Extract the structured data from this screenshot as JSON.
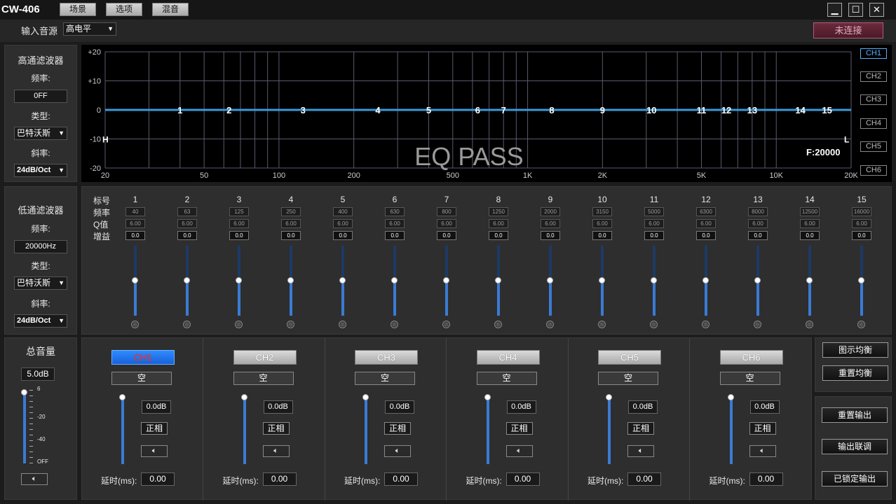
{
  "app": {
    "title": "CW-406"
  },
  "menu": [
    {
      "label": "场景"
    },
    {
      "label": "选项"
    },
    {
      "label": "混音"
    }
  ],
  "window_controls": {
    "minimize": "▁",
    "maximize": "☐",
    "close": "✕"
  },
  "input_bar": {
    "label": "输入音源",
    "value": "高电平",
    "status": "未连接"
  },
  "highpass": {
    "title": "高通滤波器",
    "freq_label": "频率:",
    "freq": "0FF",
    "type_label": "类型:",
    "type": "巴特沃斯",
    "slope_label": "斜率:",
    "slope": "24dB/Oct"
  },
  "lowpass": {
    "title": "低通滤波器",
    "freq_label": "频率:",
    "freq": "20000Hz",
    "type_label": "类型:",
    "type": "巴特沃斯",
    "slope_label": "斜率:",
    "slope": "24dB/Oct"
  },
  "graph": {
    "overlay": "EQ PASS",
    "freq_readout": "F:20000",
    "hp_marker": "H",
    "lp_marker": "L",
    "y_ticks": [
      "+20",
      "+10",
      "0",
      "-10",
      "-20"
    ],
    "x_ticks": [
      "20",
      "50",
      "100",
      "200",
      "500",
      "1K",
      "2K",
      "5K",
      "10K",
      "20K"
    ],
    "band_markers": [
      "1",
      "2",
      "3",
      "4",
      "5",
      "6",
      "7",
      "8",
      "9",
      "10",
      "11",
      "12",
      "13",
      "14",
      "15"
    ],
    "channels": [
      "CH1",
      "CH2",
      "CH3",
      "CH4",
      "CH5",
      "CH6"
    ],
    "active_channel": "CH1",
    "curve_color": "#3a9ad9"
  },
  "eq": {
    "row_labels": {
      "num": "标号",
      "freq": "频率",
      "q": "Q值",
      "gain": "增益"
    },
    "bands": [
      {
        "num": "1",
        "freq": "40",
        "q": "6.00",
        "gain": "0.0",
        "level": 0.5
      },
      {
        "num": "2",
        "freq": "63",
        "q": "6.00",
        "gain": "0.0",
        "level": 0.5
      },
      {
        "num": "3",
        "freq": "125",
        "q": "6.00",
        "gain": "0.0",
        "level": 0.5
      },
      {
        "num": "4",
        "freq": "250",
        "q": "6.00",
        "gain": "0.0",
        "level": 0.5
      },
      {
        "num": "5",
        "freq": "400",
        "q": "6.00",
        "gain": "0.0",
        "level": 0.5
      },
      {
        "num": "6",
        "freq": "630",
        "q": "6.00",
        "gain": "0.0",
        "level": 0.5
      },
      {
        "num": "7",
        "freq": "800",
        "q": "6.00",
        "gain": "0.0",
        "level": 0.5
      },
      {
        "num": "8",
        "freq": "1250",
        "q": "6.00",
        "gain": "0.0",
        "level": 0.5
      },
      {
        "num": "9",
        "freq": "2000",
        "q": "6.00",
        "gain": "0.0",
        "level": 0.5
      },
      {
        "num": "10",
        "freq": "3150",
        "q": "6.00",
        "gain": "0.0",
        "level": 0.5
      },
      {
        "num": "11",
        "freq": "5000",
        "q": "6.00",
        "gain": "0.0",
        "level": 0.5
      },
      {
        "num": "12",
        "freq": "6300",
        "q": "6.00",
        "gain": "0.0",
        "level": 0.5
      },
      {
        "num": "13",
        "freq": "8000",
        "q": "6.00",
        "gain": "0.0",
        "level": 0.5
      },
      {
        "num": "14",
        "freq": "12500",
        "q": "6.00",
        "gain": "0.0",
        "level": 0.5
      },
      {
        "num": "15",
        "freq": "16000",
        "q": "6.00",
        "gain": "0.0",
        "level": 0.5
      }
    ]
  },
  "master": {
    "title": "总音量",
    "value": "5.0dB",
    "scale": [
      "6",
      "-20",
      "-40",
      "OFF"
    ],
    "level": 0.95,
    "mute_icon": "speaker-icon"
  },
  "outputs": [
    {
      "name": "CH1",
      "slot": "空",
      "gain": "0.0dB",
      "phase": "正相",
      "delay_label": "延时(ms):",
      "delay": "0.00",
      "level": 0.97,
      "active": true
    },
    {
      "name": "CH2",
      "slot": "空",
      "gain": "0.0dB",
      "phase": "正相",
      "delay_label": "延时(ms):",
      "delay": "0.00",
      "level": 0.97,
      "active": false
    },
    {
      "name": "CH3",
      "slot": "空",
      "gain": "0.0dB",
      "phase": "正相",
      "delay_label": "延时(ms):",
      "delay": "0.00",
      "level": 0.97,
      "active": false
    },
    {
      "name": "CH4",
      "slot": "空",
      "gain": "0.0dB",
      "phase": "正相",
      "delay_label": "延时(ms):",
      "delay": "0.00",
      "level": 0.97,
      "active": false
    },
    {
      "name": "CH5",
      "slot": "空",
      "gain": "0.0dB",
      "phase": "正相",
      "delay_label": "延时(ms):",
      "delay": "0.00",
      "level": 0.97,
      "active": false
    },
    {
      "name": "CH6",
      "slot": "空",
      "gain": "0.0dB",
      "phase": "正相",
      "delay_label": "延时(ms):",
      "delay": "0.00",
      "level": 0.97,
      "active": false
    }
  ],
  "side": {
    "show_eq": "图示均衡",
    "reset_eq": "重置均衡",
    "reset_out": "重置输出",
    "link_out": "输出联调",
    "locked_out": "已锁定输出"
  },
  "colors": {
    "accent": "#3a7bd5",
    "active_ch": "#2f8cff",
    "status_border": "#b35a78"
  }
}
